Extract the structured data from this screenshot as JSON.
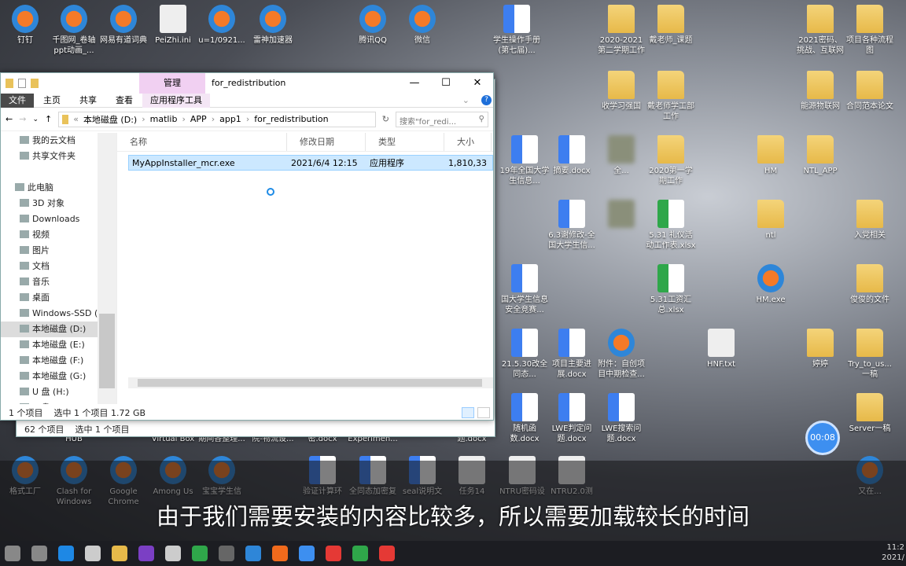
{
  "desktop_icons": [
    {
      "label": "钉钉",
      "type": "app"
    },
    {
      "label": "千图网_卷轴ppt动画_...",
      "type": "app"
    },
    {
      "label": "网易有道词典",
      "type": "app"
    },
    {
      "label": "PeiZhi.ini",
      "type": "file"
    },
    {
      "label": "u=1/0921...",
      "type": "app"
    },
    {
      "label": "雷神加速器",
      "type": "app"
    },
    {
      "label": "腾讯QQ",
      "type": "app"
    },
    {
      "label": "微信",
      "type": "app"
    },
    {
      "label": "学生操作手册(第七届)...",
      "type": "word"
    },
    {
      "label": "2020-2021第二学期工作",
      "type": "folder"
    },
    {
      "label": "戴老师_课题",
      "type": "folder"
    },
    {
      "label": "2021密码、挑战、互联网",
      "type": "folder"
    },
    {
      "label": "项目各种流程图",
      "type": "folder"
    },
    {
      "label": "收学习强国",
      "type": "folder"
    },
    {
      "label": "戴老师学工部工作",
      "type": "folder"
    },
    {
      "label": "能源物联网",
      "type": "folder"
    },
    {
      "label": "合同范本论文",
      "type": "folder"
    },
    {
      "label": "19年全国大学生信息...",
      "type": "word"
    },
    {
      "label": "摘要.docx",
      "type": "word"
    },
    {
      "label": "全...",
      "type": "blur"
    },
    {
      "label": "2020第一学期工作",
      "type": "folder"
    },
    {
      "label": "HM",
      "type": "folder"
    },
    {
      "label": "NTL_APP",
      "type": "folder"
    },
    {
      "label": "6.3谢修改-全国大学生信...",
      "type": "word"
    },
    {
      "label": "",
      "type": "blur"
    },
    {
      "label": "5.31 礼仪活动工作表.xlsx",
      "type": "excel"
    },
    {
      "label": "ntl",
      "type": "folder"
    },
    {
      "label": "入党相关",
      "type": "folder"
    },
    {
      "label": "国大学生信息安全竞赛...",
      "type": "word"
    },
    {
      "label": "5.31工资汇总.xlsx",
      "type": "excel"
    },
    {
      "label": "HM.exe",
      "type": "app"
    },
    {
      "label": "俊俊的文件",
      "type": "folder"
    },
    {
      "label": "21.5.30改全同态...",
      "type": "word"
    },
    {
      "label": "项目主要进展.docx",
      "type": "word"
    },
    {
      "label": "附件：自创项目中期检查...",
      "type": "app"
    },
    {
      "label": "HNF.txt",
      "type": "file"
    },
    {
      "label": "婷婷",
      "type": "folder"
    },
    {
      "label": "Try_to_us...一稿",
      "type": "folder"
    },
    {
      "label": "随机函数.docx",
      "type": "word"
    },
    {
      "label": "LWE判定问题.docx",
      "type": "word"
    },
    {
      "label": "LWE搜索问题.docx",
      "type": "word"
    },
    {
      "label": "Server一稿",
      "type": "folder"
    },
    {
      "label": "HUB",
      "type": "none"
    },
    {
      "label": "Virtual Box",
      "type": "none"
    },
    {
      "label": "期间各整理...",
      "type": "none"
    },
    {
      "label": "院-物流设...",
      "type": "none"
    },
    {
      "label": "密.docx",
      "type": "none"
    },
    {
      "label": "Experimen...",
      "type": "none"
    },
    {
      "label": "题.docx",
      "type": "none"
    },
    {
      "label": "格式工厂",
      "type": "app"
    },
    {
      "label": "Clash for Windows",
      "type": "app"
    },
    {
      "label": "Google Chrome",
      "type": "app"
    },
    {
      "label": "Among Us",
      "type": "app"
    },
    {
      "label": "宝宝学生信",
      "type": "app"
    },
    {
      "label": "验证计算环",
      "type": "word"
    },
    {
      "label": "全同态加密复",
      "type": "word"
    },
    {
      "label": "seal说明文",
      "type": "word"
    },
    {
      "label": "任务14",
      "type": "file"
    },
    {
      "label": "NTRU密码设",
      "type": "file"
    },
    {
      "label": "NTRU2.0测",
      "type": "file"
    },
    {
      "label": "又在...",
      "type": "app"
    }
  ],
  "back_window": {
    "status_count": "62 个项目",
    "status_selected": "选中 1 个项目"
  },
  "explorer": {
    "manage_tab": "管理",
    "title": "for_redistribution",
    "ribbon": {
      "file": "文件",
      "home": "主页",
      "share": "共享",
      "view": "查看",
      "app_tools": "应用程序工具"
    },
    "breadcrumb": [
      "本地磁盘 (D:)",
      "matlib",
      "APP",
      "app1",
      "for_redistribution"
    ],
    "search_placeholder": "搜索\"for_redi...",
    "nav": [
      {
        "label": "我的云文档"
      },
      {
        "label": "共享文件夹"
      },
      {
        "label": ""
      },
      {
        "label": "此电脑"
      },
      {
        "label": "3D 对象"
      },
      {
        "label": "Downloads"
      },
      {
        "label": "视频"
      },
      {
        "label": "图片"
      },
      {
        "label": "文档"
      },
      {
        "label": "音乐"
      },
      {
        "label": "桌面"
      },
      {
        "label": "Windows-SSD (C:)"
      },
      {
        "label": "本地磁盘 (D:)",
        "selected": true
      },
      {
        "label": "本地磁盘 (E:)"
      },
      {
        "label": "本地磁盘 (F:)"
      },
      {
        "label": "本地磁盘 (G:)"
      },
      {
        "label": "U 盘 (H:)"
      },
      {
        "label": "U 盘 (H:)"
      }
    ],
    "columns": [
      "名称",
      "修改日期",
      "类型",
      "大小"
    ],
    "files": [
      {
        "name": "MyAppInstaller_mcr.exe",
        "date": "2021/6/4 12:15",
        "type": "应用程序",
        "size": "1,810,33"
      }
    ],
    "status_count": "1 个项目",
    "status_selected": "选中 1 个项目  1.72 GB"
  },
  "timer": "00:08",
  "subtitle": "由于我们需要安装的内容比较多，所以需要加载较长的时间",
  "clock": {
    "time": "11:2",
    "date": "2021/"
  },
  "taskbar_colors": [
    "#888",
    "#888",
    "#1e88e5",
    "#ccc",
    "#e6b94a",
    "#7b3fc4",
    "#ccc",
    "#2fa74a",
    "#666",
    "#2e86d8",
    "#f06a1c",
    "#3d8ff0",
    "#e53935",
    "#2fa74a",
    "#e53935"
  ]
}
